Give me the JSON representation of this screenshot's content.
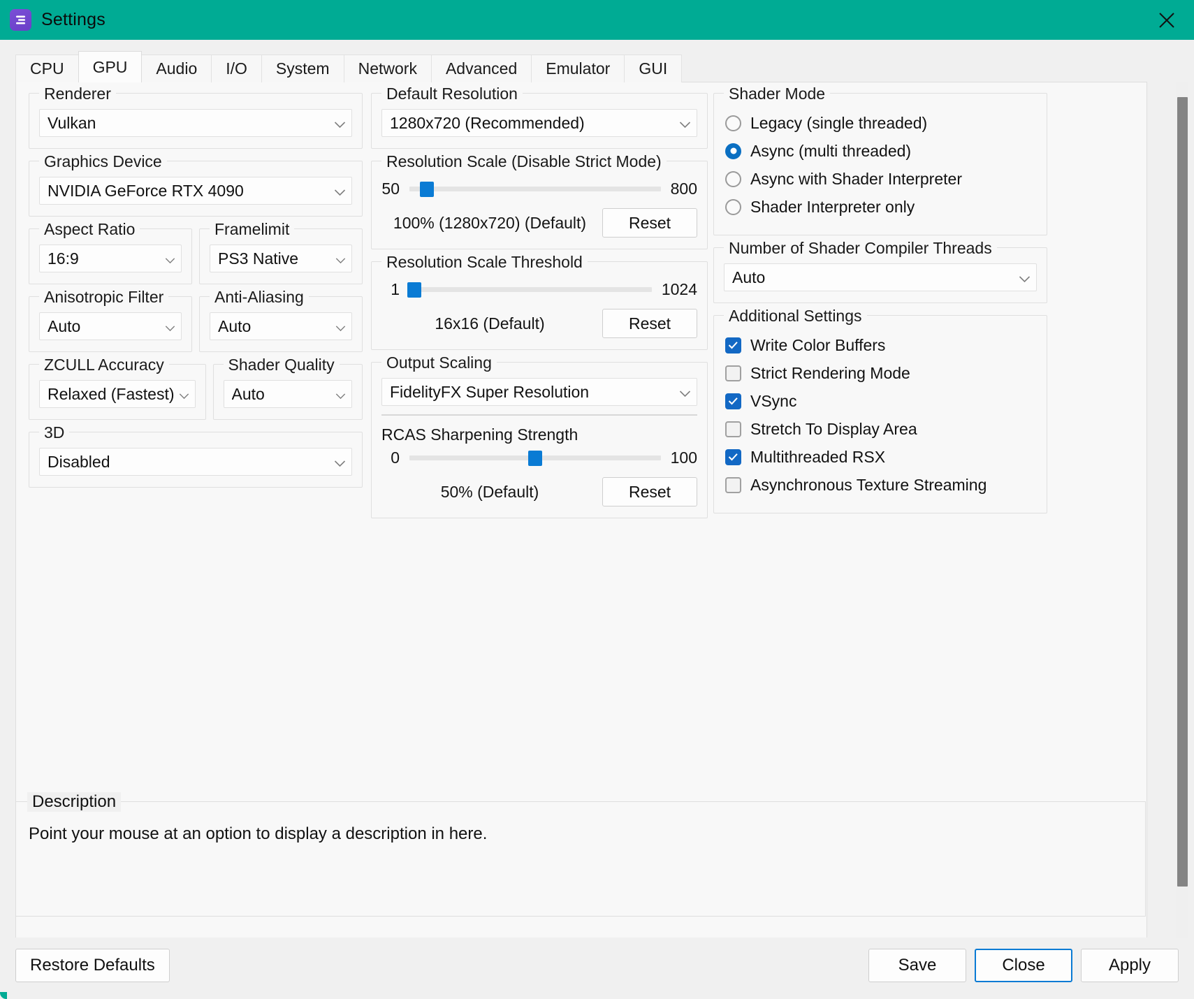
{
  "window": {
    "title": "Settings",
    "icon": "rpcs3-logo-icon",
    "close_label": "×",
    "titlebar_color": "#00ab94"
  },
  "tabs": [
    {
      "label": "CPU",
      "active": false
    },
    {
      "label": "GPU",
      "active": true
    },
    {
      "label": "Audio",
      "active": false
    },
    {
      "label": "I/O",
      "active": false
    },
    {
      "label": "System",
      "active": false
    },
    {
      "label": "Network",
      "active": false
    },
    {
      "label": "Advanced",
      "active": false
    },
    {
      "label": "Emulator",
      "active": false
    },
    {
      "label": "GUI",
      "active": false
    }
  ],
  "left_column": {
    "renderer": {
      "title": "Renderer",
      "value": "Vulkan"
    },
    "graphics_device": {
      "title": "Graphics Device",
      "value": "NVIDIA GeForce RTX 4090"
    },
    "aspect_ratio": {
      "title": "Aspect Ratio",
      "value": "16:9"
    },
    "framelimit": {
      "title": "Framelimit",
      "value": "PS3 Native"
    },
    "anisotropic": {
      "title": "Anisotropic Filter",
      "value": "Auto"
    },
    "antialiasing": {
      "title": "Anti-Aliasing",
      "value": "Auto"
    },
    "zcull": {
      "title": "ZCULL Accuracy",
      "value": "Relaxed (Fastest)"
    },
    "shader_quality": {
      "title": "Shader Quality",
      "value": "Auto"
    },
    "three_d": {
      "title": "3D",
      "value": "Disabled"
    }
  },
  "middle_column": {
    "default_resolution": {
      "title": "Default Resolution",
      "value": "1280x720 (Recommended)"
    },
    "resolution_scale": {
      "title": "Resolution Scale (Disable Strict Mode)",
      "min_label": "50",
      "max_label": "800",
      "value_label": "100% (1280x720) (Default)",
      "reset_label": "Reset",
      "handle_percent": 7
    },
    "resolution_scale_threshold": {
      "title": "Resolution Scale Threshold",
      "min_label": "1",
      "max_label": "1024",
      "value_label": "16x16 (Default)",
      "reset_label": "Reset",
      "handle_percent": 2
    },
    "output_scaling": {
      "title": "Output Scaling",
      "value": "FidelityFX Super Resolution",
      "sharpening_label": "RCAS Sharpening Strength",
      "min_label": "0",
      "max_label": "100",
      "value_label": "50% (Default)",
      "reset_label": "Reset",
      "handle_percent": 50
    }
  },
  "right_column": {
    "shader_mode": {
      "title": "Shader Mode",
      "options": [
        {
          "label": "Legacy (single threaded)",
          "selected": false
        },
        {
          "label": "Async (multi threaded)",
          "selected": true
        },
        {
          "label": "Async with Shader Interpreter",
          "selected": false
        },
        {
          "label": "Shader Interpreter only",
          "selected": false
        }
      ]
    },
    "shader_threads": {
      "title": "Number of Shader Compiler Threads",
      "value": "Auto"
    },
    "additional_settings": {
      "title": "Additional Settings",
      "options": [
        {
          "label": "Write Color Buffers",
          "checked": true
        },
        {
          "label": "Strict Rendering Mode",
          "checked": false
        },
        {
          "label": "VSync",
          "checked": true
        },
        {
          "label": "Stretch To Display Area",
          "checked": false
        },
        {
          "label": "Multithreaded RSX",
          "checked": true
        },
        {
          "label": "Asynchronous Texture Streaming",
          "checked": false
        }
      ]
    }
  },
  "description": {
    "title": "Description",
    "text": "Point your mouse at an option to display a description in here."
  },
  "footer": {
    "restore_defaults": "Restore Defaults",
    "save": "Save",
    "close": "Close",
    "apply": "Apply"
  },
  "colors": {
    "accent_teal": "#00ab94",
    "accent_blue": "#0a7bd4",
    "check_blue": "#1268c4"
  }
}
